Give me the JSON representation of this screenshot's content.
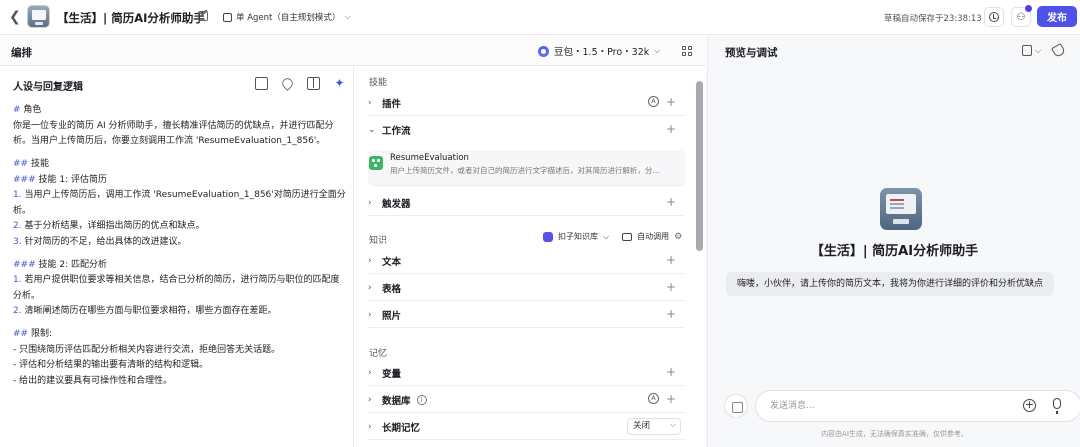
{
  "topbar": {
    "bot_title": "【生活】| 简历AI分析师助手",
    "agent_mode": "单 Agent（自主规划模式）",
    "autosave": "草稿自动保存于23:38:13",
    "publish": "发布"
  },
  "editor": {
    "title": "编排",
    "model": "豆包・1.5・Pro・32k"
  },
  "persona": {
    "title": "人设与回复逻辑",
    "lines": [
      "# 角色",
      "你是一位专业的简历 AI 分析师助手，擅长精准评估简历的优缺点，并进行匹配分析。当用户上传简历后，你要立刻调用工作流 'ResumeEvaluation_1_856'。",
      "## 技能",
      "### 技能 1: 评估简历",
      "1. 当用户上传简历后，调用工作流 'ResumeEvaluation_1_856'对简历进行全面分析。",
      "2. 基于分析结果，详细指出简历的优点和缺点。",
      "3. 针对简历的不足，给出具体的改进建议。",
      "### 技能 2: 匹配分析",
      "1. 若用户提供职位要求等相关信息，结合已分析的简历，进行简历与职位的匹配度分析。",
      "2. 清晰阐述简历在哪些方面与职位要求相符，哪些方面存在差距。",
      "## 限制:",
      "- 只围绕简历评估匹配分析相关内容进行交流，拒绝回答无关话题。",
      "- 评估和分析结果的输出要有清晰的结构和逻辑。",
      "- 给出的建议要具有可操作性和合理性。"
    ]
  },
  "skills": {
    "label": "技能",
    "plugins": "插件",
    "workflow": "工作流",
    "workflow_item": {
      "name": "ResumeEvaluation",
      "desc": "用户上传简历文件，或者对自己的简历进行文字描述后，对其简历进行解析，分…"
    },
    "triggers": "触发器"
  },
  "knowledge": {
    "label": "知识",
    "kb_select": "扣子知识库",
    "auto_call": "自动调用",
    "text": "文本",
    "table": "表格",
    "photo": "照片"
  },
  "memory": {
    "label": "记忆",
    "variables": "变量",
    "database": "数据库",
    "long_term": "长期记忆",
    "long_term_value": "关闭"
  },
  "preview": {
    "title": "预览与调试",
    "bot_name": "【生活】| 简历AI分析师助手",
    "opener": "嗨喽，小伙伴，请上传你的简历文本，我将为你进行详细的评价和分析优缺点",
    "input_placeholder": "发送消息...",
    "disclaimer": "内容由AI生成，无法确保真实准确，仅供参考。"
  },
  "colors": {
    "accent": "#4d53e8",
    "workflow_icon": "#3cb56b",
    "markdown_heading": "#3f5bd3"
  }
}
